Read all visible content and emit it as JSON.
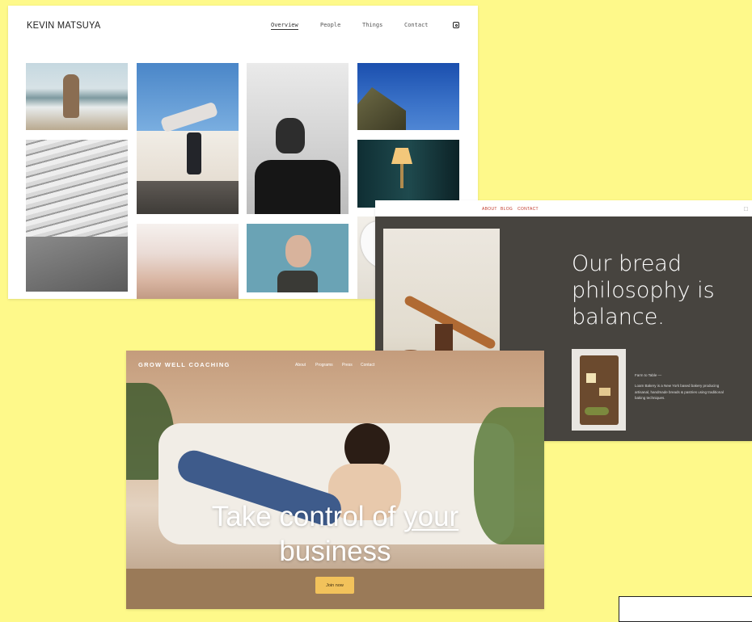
{
  "portfolio": {
    "brand": "KEVIN MATSUYA",
    "nav": [
      "Overview",
      "People",
      "Things",
      "Contact"
    ],
    "active_nav": "Overview",
    "social_icon": "instagram-icon"
  },
  "bakery": {
    "nav": [
      "ABOUT",
      "BLOG",
      "CONTACT"
    ],
    "cart_icon": "cart-icon",
    "headline": "Our bread philosophy is balance.",
    "blurb_title": "Farm to Table —",
    "blurb": "Loam Bakery is a New York based bakery producing artisanal, handmade breads & pastries using traditional baking techniques.",
    "nav_color": "#c0392b",
    "background": "#47443f"
  },
  "coaching": {
    "logo": "GROW WELL COACHING",
    "nav": [
      "About",
      "Programs",
      "Press",
      "Contact"
    ],
    "hero_line1_a": "Take control of ",
    "hero_line1_b": "your",
    "hero_line2": "business",
    "cta": "Join now",
    "cta_color": "#f2c25b"
  },
  "colors": {
    "page_background": "#fef98a"
  }
}
